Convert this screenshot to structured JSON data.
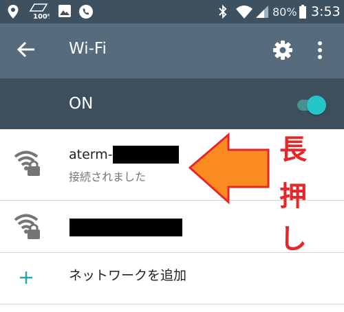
{
  "status_bar": {
    "signal_badge": "100%",
    "battery_text": "80%",
    "clock": "3:53",
    "icons": [
      "location-icon",
      "sim-data-icon",
      "image-icon",
      "phone-icon",
      "bluetooth-icon",
      "wifi-status-icon",
      "signal-icon",
      "battery-icon"
    ]
  },
  "app_bar": {
    "title": "Wi-Fi",
    "back_icon": "arrow-back-icon",
    "settings_icon": "gear-icon",
    "more_icon": "more-vert-icon"
  },
  "wifi_toggle": {
    "label": "ON",
    "state": "on",
    "accent_color": "#26c6c8"
  },
  "networks": [
    {
      "name": "aterm-",
      "status": "接続されました",
      "secured": true,
      "name_redacted": true
    },
    {
      "name": "",
      "status": "",
      "secured": true,
      "name_redacted": true
    }
  ],
  "add_network": {
    "label": "ネットワークを追加",
    "icon": "plus-icon"
  },
  "annotation": {
    "text": [
      "長",
      "押",
      "し"
    ],
    "color": "#e5262a",
    "arrow_color": "#f98b21"
  }
}
